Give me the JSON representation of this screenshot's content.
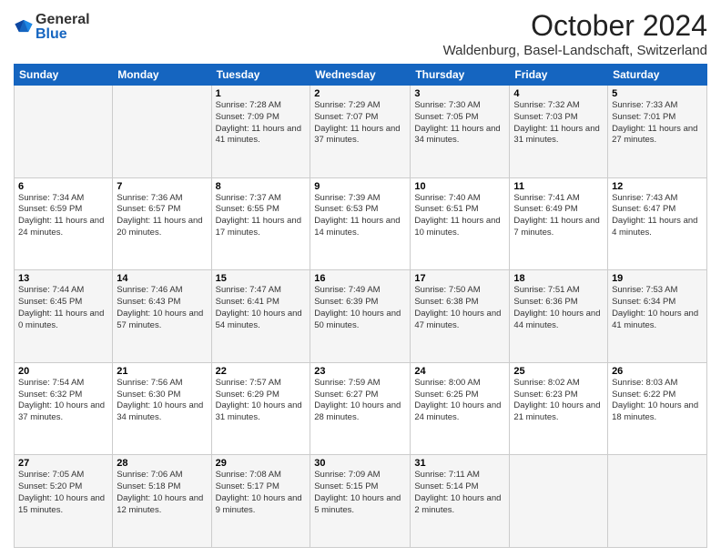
{
  "logo": {
    "general": "General",
    "blue": "Blue"
  },
  "title": "October 2024",
  "location": "Waldenburg, Basel-Landschaft, Switzerland",
  "days_of_week": [
    "Sunday",
    "Monday",
    "Tuesday",
    "Wednesday",
    "Thursday",
    "Friday",
    "Saturday"
  ],
  "weeks": [
    [
      {
        "day": "",
        "sunrise": "",
        "sunset": "",
        "daylight": ""
      },
      {
        "day": "",
        "sunrise": "",
        "sunset": "",
        "daylight": ""
      },
      {
        "day": "1",
        "sunrise": "Sunrise: 7:28 AM",
        "sunset": "Sunset: 7:09 PM",
        "daylight": "Daylight: 11 hours and 41 minutes."
      },
      {
        "day": "2",
        "sunrise": "Sunrise: 7:29 AM",
        "sunset": "Sunset: 7:07 PM",
        "daylight": "Daylight: 11 hours and 37 minutes."
      },
      {
        "day": "3",
        "sunrise": "Sunrise: 7:30 AM",
        "sunset": "Sunset: 7:05 PM",
        "daylight": "Daylight: 11 hours and 34 minutes."
      },
      {
        "day": "4",
        "sunrise": "Sunrise: 7:32 AM",
        "sunset": "Sunset: 7:03 PM",
        "daylight": "Daylight: 11 hours and 31 minutes."
      },
      {
        "day": "5",
        "sunrise": "Sunrise: 7:33 AM",
        "sunset": "Sunset: 7:01 PM",
        "daylight": "Daylight: 11 hours and 27 minutes."
      }
    ],
    [
      {
        "day": "6",
        "sunrise": "Sunrise: 7:34 AM",
        "sunset": "Sunset: 6:59 PM",
        "daylight": "Daylight: 11 hours and 24 minutes."
      },
      {
        "day": "7",
        "sunrise": "Sunrise: 7:36 AM",
        "sunset": "Sunset: 6:57 PM",
        "daylight": "Daylight: 11 hours and 20 minutes."
      },
      {
        "day": "8",
        "sunrise": "Sunrise: 7:37 AM",
        "sunset": "Sunset: 6:55 PM",
        "daylight": "Daylight: 11 hours and 17 minutes."
      },
      {
        "day": "9",
        "sunrise": "Sunrise: 7:39 AM",
        "sunset": "Sunset: 6:53 PM",
        "daylight": "Daylight: 11 hours and 14 minutes."
      },
      {
        "day": "10",
        "sunrise": "Sunrise: 7:40 AM",
        "sunset": "Sunset: 6:51 PM",
        "daylight": "Daylight: 11 hours and 10 minutes."
      },
      {
        "day": "11",
        "sunrise": "Sunrise: 7:41 AM",
        "sunset": "Sunset: 6:49 PM",
        "daylight": "Daylight: 11 hours and 7 minutes."
      },
      {
        "day": "12",
        "sunrise": "Sunrise: 7:43 AM",
        "sunset": "Sunset: 6:47 PM",
        "daylight": "Daylight: 11 hours and 4 minutes."
      }
    ],
    [
      {
        "day": "13",
        "sunrise": "Sunrise: 7:44 AM",
        "sunset": "Sunset: 6:45 PM",
        "daylight": "Daylight: 11 hours and 0 minutes."
      },
      {
        "day": "14",
        "sunrise": "Sunrise: 7:46 AM",
        "sunset": "Sunset: 6:43 PM",
        "daylight": "Daylight: 10 hours and 57 minutes."
      },
      {
        "day": "15",
        "sunrise": "Sunrise: 7:47 AM",
        "sunset": "Sunset: 6:41 PM",
        "daylight": "Daylight: 10 hours and 54 minutes."
      },
      {
        "day": "16",
        "sunrise": "Sunrise: 7:49 AM",
        "sunset": "Sunset: 6:39 PM",
        "daylight": "Daylight: 10 hours and 50 minutes."
      },
      {
        "day": "17",
        "sunrise": "Sunrise: 7:50 AM",
        "sunset": "Sunset: 6:38 PM",
        "daylight": "Daylight: 10 hours and 47 minutes."
      },
      {
        "day": "18",
        "sunrise": "Sunrise: 7:51 AM",
        "sunset": "Sunset: 6:36 PM",
        "daylight": "Daylight: 10 hours and 44 minutes."
      },
      {
        "day": "19",
        "sunrise": "Sunrise: 7:53 AM",
        "sunset": "Sunset: 6:34 PM",
        "daylight": "Daylight: 10 hours and 41 minutes."
      }
    ],
    [
      {
        "day": "20",
        "sunrise": "Sunrise: 7:54 AM",
        "sunset": "Sunset: 6:32 PM",
        "daylight": "Daylight: 10 hours and 37 minutes."
      },
      {
        "day": "21",
        "sunrise": "Sunrise: 7:56 AM",
        "sunset": "Sunset: 6:30 PM",
        "daylight": "Daylight: 10 hours and 34 minutes."
      },
      {
        "day": "22",
        "sunrise": "Sunrise: 7:57 AM",
        "sunset": "Sunset: 6:29 PM",
        "daylight": "Daylight: 10 hours and 31 minutes."
      },
      {
        "day": "23",
        "sunrise": "Sunrise: 7:59 AM",
        "sunset": "Sunset: 6:27 PM",
        "daylight": "Daylight: 10 hours and 28 minutes."
      },
      {
        "day": "24",
        "sunrise": "Sunrise: 8:00 AM",
        "sunset": "Sunset: 6:25 PM",
        "daylight": "Daylight: 10 hours and 24 minutes."
      },
      {
        "day": "25",
        "sunrise": "Sunrise: 8:02 AM",
        "sunset": "Sunset: 6:23 PM",
        "daylight": "Daylight: 10 hours and 21 minutes."
      },
      {
        "day": "26",
        "sunrise": "Sunrise: 8:03 AM",
        "sunset": "Sunset: 6:22 PM",
        "daylight": "Daylight: 10 hours and 18 minutes."
      }
    ],
    [
      {
        "day": "27",
        "sunrise": "Sunrise: 7:05 AM",
        "sunset": "Sunset: 5:20 PM",
        "daylight": "Daylight: 10 hours and 15 minutes."
      },
      {
        "day": "28",
        "sunrise": "Sunrise: 7:06 AM",
        "sunset": "Sunset: 5:18 PM",
        "daylight": "Daylight: 10 hours and 12 minutes."
      },
      {
        "day": "29",
        "sunrise": "Sunrise: 7:08 AM",
        "sunset": "Sunset: 5:17 PM",
        "daylight": "Daylight: 10 hours and 9 minutes."
      },
      {
        "day": "30",
        "sunrise": "Sunrise: 7:09 AM",
        "sunset": "Sunset: 5:15 PM",
        "daylight": "Daylight: 10 hours and 5 minutes."
      },
      {
        "day": "31",
        "sunrise": "Sunrise: 7:11 AM",
        "sunset": "Sunset: 5:14 PM",
        "daylight": "Daylight: 10 hours and 2 minutes."
      },
      {
        "day": "",
        "sunrise": "",
        "sunset": "",
        "daylight": ""
      },
      {
        "day": "",
        "sunrise": "",
        "sunset": "",
        "daylight": ""
      }
    ]
  ]
}
